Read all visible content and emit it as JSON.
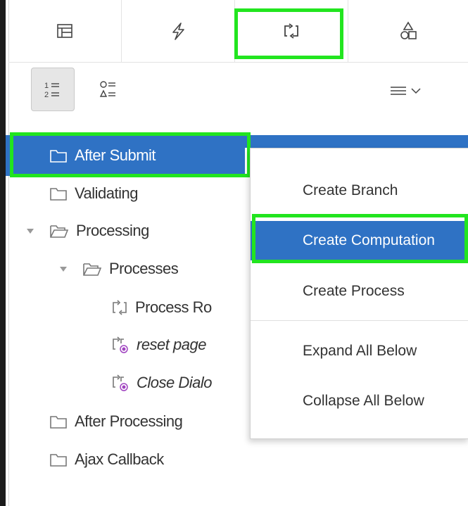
{
  "tabs": [
    {
      "icon": "table-layout-icon",
      "name": "rendering"
    },
    {
      "icon": "lightning-icon",
      "name": "dynamic-actions"
    },
    {
      "icon": "processing-arrows-icon",
      "name": "processing"
    },
    {
      "icon": "shared-components-icon",
      "name": "shared-components"
    }
  ],
  "toolbar": {
    "view_ordered_icon": "ordered-list-icon",
    "view_component_icon": "component-list-icon",
    "menu_icon": "menu-chevron-icon"
  },
  "tree": {
    "after_submit": "After Submit",
    "validating": "Validating",
    "processing": "Processing",
    "processes": "Processes",
    "process_row": "Process Ro",
    "reset_page": "reset page",
    "close_dialog": "Close Dialo",
    "after_processing": "After Processing",
    "ajax_callback": "Ajax Callback"
  },
  "context_menu": {
    "create_branch": "Create Branch",
    "create_computation": "Create Computation",
    "create_process": "Create Process",
    "expand_all_below": "Expand All Below",
    "collapse_all_below": "Collapse All Below"
  },
  "colors": {
    "selection": "#2f72c4",
    "highlight": "#22e51f"
  }
}
